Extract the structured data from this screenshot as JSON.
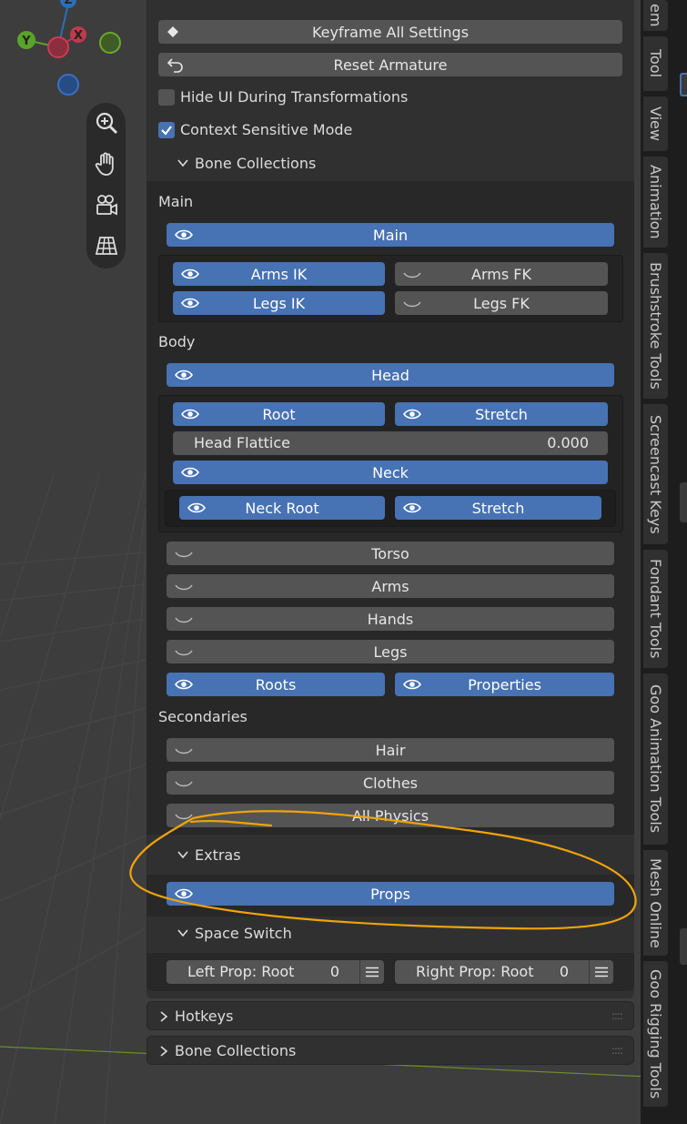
{
  "viewport": {
    "gizmo": {
      "x": "X",
      "y": "Y",
      "z": "Z"
    },
    "tools": [
      {
        "name": "zoom-icon"
      },
      {
        "name": "hand-icon"
      },
      {
        "name": "camera-icon"
      },
      {
        "name": "grid-icon"
      }
    ]
  },
  "settings": {
    "keyframe_all": "Keyframe All Settings",
    "reset_armature": "Reset Armature",
    "hide_ui": "Hide UI During Transformations",
    "hide_ui_checked": false,
    "context_sensitive": "Context Sensitive Mode",
    "context_sensitive_checked": true
  },
  "bone_collections": {
    "header": "Bone Collections",
    "main_label": "Main",
    "main": "Main",
    "arms_ik": "Arms IK",
    "arms_fk": "Arms FK",
    "legs_ik": "Legs IK",
    "legs_fk": "Legs FK",
    "body_label": "Body",
    "head": "Head",
    "root": "Root",
    "stretch": "Stretch",
    "head_flattice": "Head Flattice",
    "head_flattice_value": "0.000",
    "neck": "Neck",
    "neck_root": "Neck Root",
    "neck_stretch": "Stretch",
    "torso": "Torso",
    "arms": "Arms",
    "hands": "Hands",
    "legs": "Legs",
    "roots": "Roots",
    "properties": "Properties",
    "secondaries_label": "Secondaries",
    "hair": "Hair",
    "clothes": "Clothes",
    "all_physics": "All Physics"
  },
  "extras": {
    "header": "Extras",
    "props": "Props"
  },
  "space_switch": {
    "header": "Space Switch",
    "left_prop": "Left Prop: Root",
    "left_value": "0",
    "right_prop": "Right Prop: Root",
    "right_value": "0"
  },
  "panels": {
    "hotkeys": "Hotkeys",
    "bone_collections": "Bone Collections"
  },
  "tabs": [
    "em",
    "Tool",
    "View",
    "Animation",
    "Brushstroke Tools",
    "Screencast Keys",
    "Fondant Tools",
    "Goo Animation Tools",
    "Mesh Online",
    "Goo Rigging Tools"
  ],
  "colors": {
    "accent": "#4772b3",
    "annotation": "#f0a30a"
  }
}
